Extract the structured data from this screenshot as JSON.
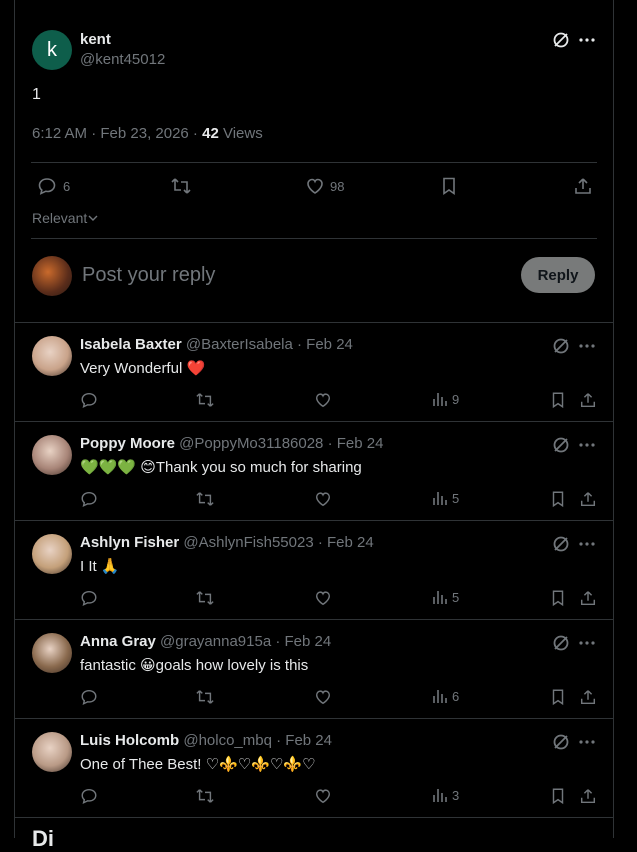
{
  "post": {
    "author_initial": "k",
    "author_name": "kent",
    "author_handle": "@kent45012",
    "text": "1",
    "time": "6:12 AM · Feb 23, 2026 · ",
    "views_count": "42",
    "views_label": " Views",
    "replies": "6",
    "likes": "98"
  },
  "sort": {
    "label": "Relevant"
  },
  "composer": {
    "placeholder": "Post your reply",
    "button": "Reply"
  },
  "replies": [
    {
      "name": "Isabela Baxter",
      "meta": " @BaxterIsabela · Feb 24",
      "text": "Very Wonderful ❤️",
      "views": "9",
      "avatar_color": "#c9a38a"
    },
    {
      "name": "Poppy Moore",
      "meta": " @PoppyMo31186028 · Feb 24",
      "text": "💚💚💚 😊Thank you so much for sharing",
      "views": "5",
      "avatar_color": "#a88578"
    },
    {
      "name": "Ashlyn Fisher",
      "meta": " @AshlynFish55023 · Feb 24",
      "text": "I  It 🙏",
      "views": "5",
      "avatar_color": "#c4a07a"
    },
    {
      "name": "Anna Gray",
      "meta": " @grayanna915a · Feb 24",
      "text": "fantastic 😀goals how lovely is this",
      "views": "6",
      "avatar_color": "#8a6a4e"
    },
    {
      "name": "Luis Holcomb",
      "meta": " @holco_mbq · Feb 24",
      "text": "One of Thee Best! ♡⚜️♡⚜️♡⚜️♡",
      "views": "3",
      "avatar_color": "#b99a86"
    }
  ],
  "footer_partial": "Di",
  "colors": {
    "background": "#000000",
    "border": "#2f3336",
    "muted": "#71767b",
    "text": "#e7e9ea",
    "reply_button": "#787a7a",
    "heart": "#e0245e"
  }
}
